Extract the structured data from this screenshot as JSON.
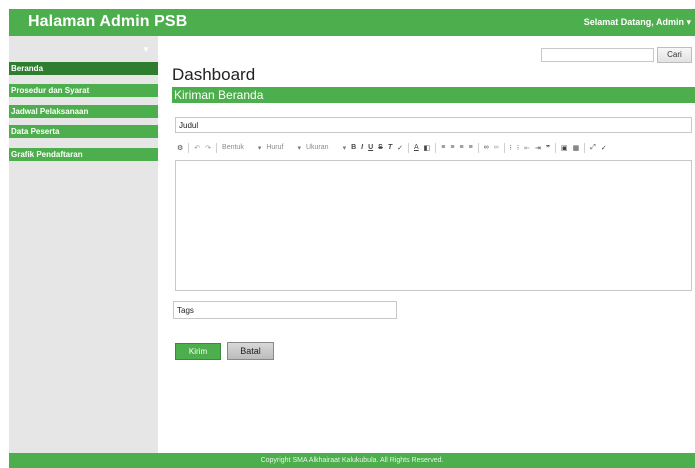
{
  "header": {
    "brand": "Halaman Admin PSB",
    "welcome": "Selamat Datang, Admin ▾"
  },
  "sidebar": {
    "items": [
      {
        "label": "Beranda",
        "active": true
      },
      {
        "label": "Prosedur dan Syarat"
      },
      {
        "label": "Jadwal Pelaksanaan"
      },
      {
        "label": "Data Peserta"
      },
      {
        "label": "Grafik Pendaftaran"
      }
    ]
  },
  "search": {
    "value": "",
    "button_label": "Cari"
  },
  "main": {
    "page_title": "Dashboard",
    "section_title": "Kiriman Beranda",
    "title_field": "Judul",
    "editor_toolbar": {
      "format_select": "Bentuk",
      "font_select": "Huruf",
      "size_select": "Ukuran"
    },
    "tags_field": "Tags",
    "submit_label": "Kirim",
    "cancel_label": "Batal"
  },
  "footer": {
    "copyright": "Copyright SMA Alkhairaat Kalukubula. All Rights Reserved."
  },
  "colors": {
    "accent": "#4cae4c",
    "accent_dark": "#2f7d2f",
    "sidebar_bg": "#e6e6e6"
  }
}
